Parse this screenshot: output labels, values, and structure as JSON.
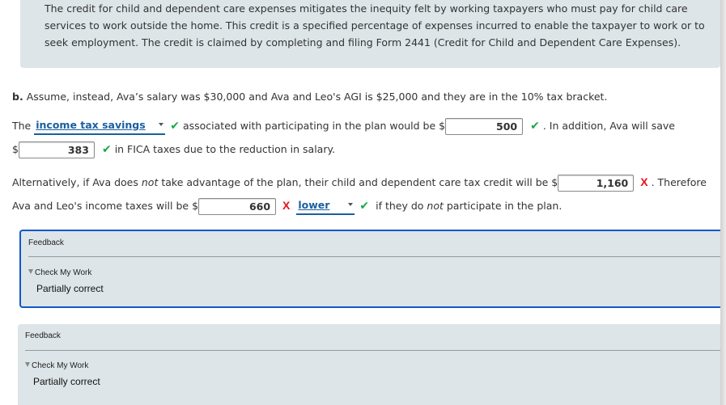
{
  "intro": {
    "text": "The credit for child and dependent care expenses mitigates the inequity felt by working taxpayers who must pay for child care services to work outside the home. This credit is a specified percentage of expenses incurred to enable the taxpayer to work or to seek employment. The credit is claimed by completing and filing Form 2441 (Credit for Child and Dependent Care Expenses)."
  },
  "part_b": {
    "label": "b.",
    "text": "Assume, instead, Ava’s salary was $30,000 and Ava and Leo's AGI is $25,000 and they are in the 10% tax bracket."
  },
  "q1": {
    "prefix": "The",
    "dropdown_value": "income tax savings",
    "dropdown_status": "correct",
    "middle": "associated with participating in the plan would be $",
    "input1_value": "500",
    "input1_status": "correct",
    "suffix1": ". In addition, Ava will save",
    "currency": "$",
    "input2_value": "383",
    "input2_status": "correct",
    "suffix2": "in FICA taxes due to the reduction in salary."
  },
  "q2": {
    "prefix_a": "Alternatively, if Ava does",
    "emph_not": "not",
    "prefix_b": "take advantage of the plan, their child and dependent care tax credit will be $",
    "input1_value": "1,160",
    "input1_status": "incorrect",
    "suffix1": ". Therefore",
    "line2_prefix": "Ava and Leo's income taxes will be $",
    "input2_value": "660",
    "input2_status": "incorrect",
    "dropdown_value": "lower",
    "dropdown_status": "correct",
    "line2_suffix_a": "if they do",
    "line2_emph": "not",
    "line2_suffix_b": "participate in the plan."
  },
  "marks": {
    "check": "✔",
    "x": "X"
  },
  "feedback": [
    {
      "title": "Feedback",
      "toggle": "Check My Work",
      "status": "Partially correct"
    },
    {
      "title": "Feedback",
      "toggle": "Check My Work",
      "status": "Partially correct"
    }
  ],
  "colors": {
    "correct": "#1aa84a",
    "incorrect": "#e8121f",
    "accent": "#1257c9",
    "panel": "#dde5e8"
  }
}
